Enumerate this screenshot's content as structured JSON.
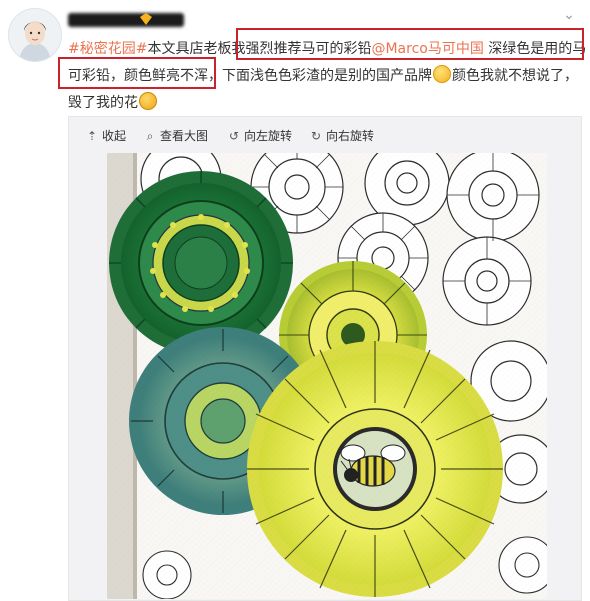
{
  "post": {
    "text_line1_tag": "#秘密花园#",
    "text_line1_rest": "本文具店老板我强烈推荐马可的彩铅",
    "text_mention": "@Marco马可中国",
    "text_line1_tail": " 深绿色是用的马",
    "text_line2": "可彩铅，颜色鲜亮不浑，下面浅色色彩渣的是别的国产品牌",
    "text_line2_tail": "颜色我就不想说了，",
    "text_line3": "毁了我的花",
    "emoji_1": "laughing-tears-emoji",
    "emoji_2": "shocked-emoji"
  },
  "toolbar": {
    "collapse": "收起",
    "view_large": "查看大图",
    "rotate_left": "向左旋转",
    "rotate_right": "向右旋转"
  },
  "colors": {
    "link": "#eb7350",
    "highlight_box": "#c8232c",
    "media_bg": "#f2f2f5"
  }
}
